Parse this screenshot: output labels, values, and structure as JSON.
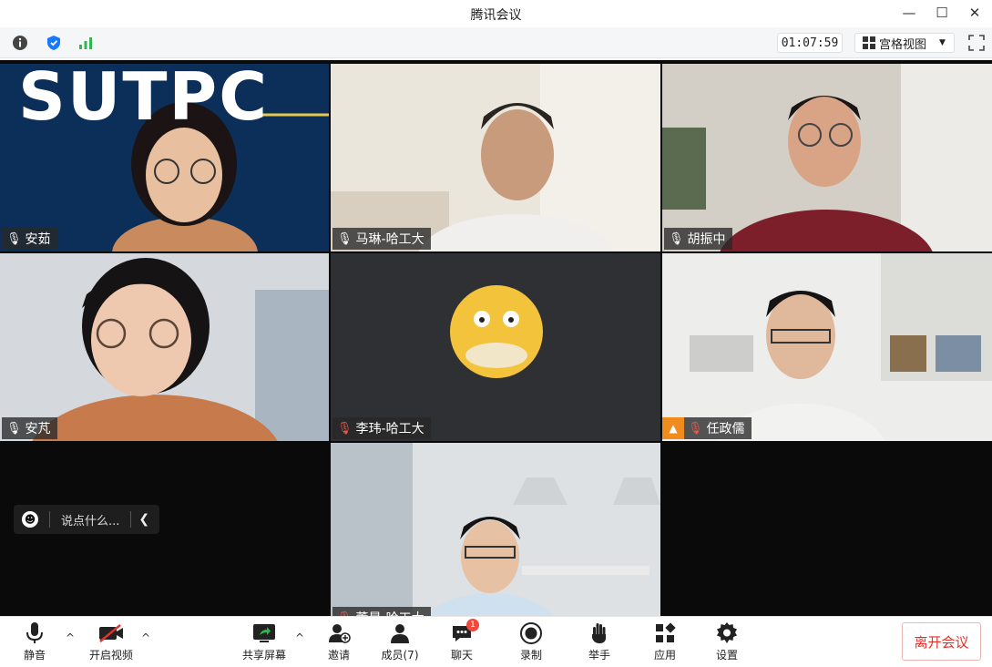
{
  "window": {
    "title": "腾讯会议"
  },
  "toolbar": {
    "timer": "01:07:59",
    "view_mode": "宫格视图"
  },
  "participants": [
    {
      "name": "安茹"
    },
    {
      "name": "马琳-哈工大"
    },
    {
      "name": "胡振中"
    },
    {
      "name": "安芃"
    },
    {
      "name": "李玮-哈工大"
    },
    {
      "name": "任政儒"
    },
    {
      "name": "董昊-哈工大"
    }
  ],
  "tile_texts": {
    "banner": "SUTPC"
  },
  "chat": {
    "placeholder": "说点什么..."
  },
  "bottom_bar": {
    "mute": "静音",
    "video": "开启视频",
    "share": "共享屏幕",
    "invite": "邀请",
    "members": "成员(7)",
    "chat": "聊天",
    "chat_badge": "1",
    "record": "录制",
    "raise_hand": "举手",
    "apps": "应用",
    "settings": "设置",
    "leave": "离开会议"
  },
  "colors": {
    "accent": "#1677ff",
    "leave": "#e0312b",
    "signal": "#2db84d",
    "host": "#f08c1e"
  }
}
